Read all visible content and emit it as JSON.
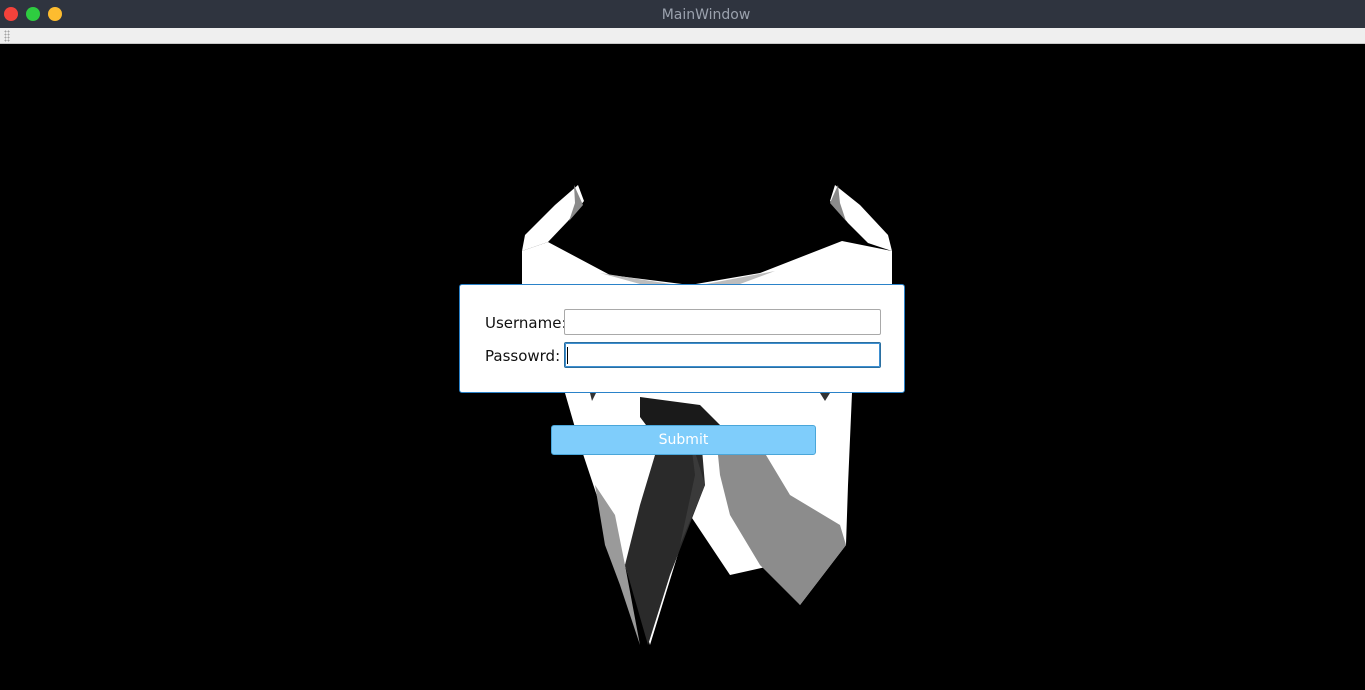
{
  "window": {
    "title": "MainWindow",
    "controls": {
      "close_color": "#f4423b",
      "maximize_color": "#2ecc40",
      "minimize_color": "#fdbc2f"
    }
  },
  "toolbar": {
    "grip_icon": "toolbar-grip-icon"
  },
  "background": {
    "art": "suit-collar-and-tie-illustration",
    "color": "#000000"
  },
  "login_form": {
    "username_label": "Username:",
    "username_value": "",
    "password_label": "Passowrd:",
    "password_value": "",
    "focused_field": "password",
    "accent_color": "#2a82c9"
  },
  "actions": {
    "submit_label": "Submit",
    "submit_color": "#7fcdfb"
  }
}
